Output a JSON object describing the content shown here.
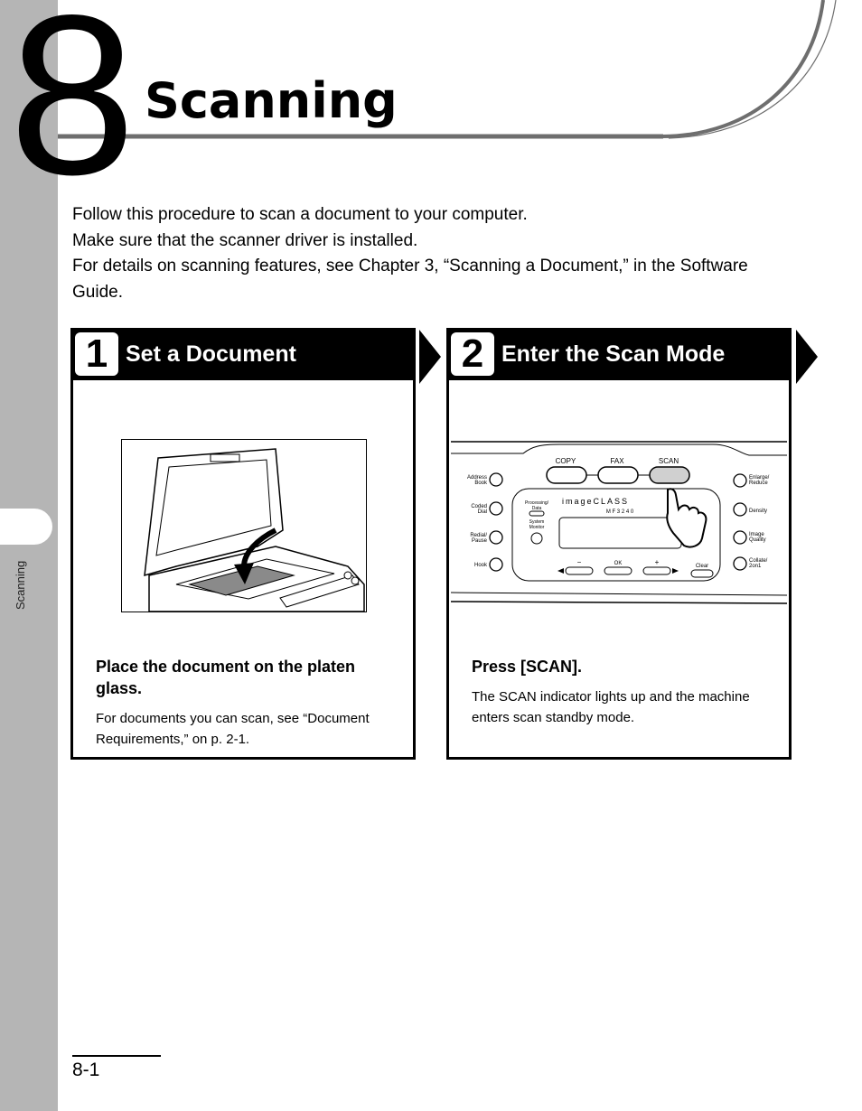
{
  "chapter": {
    "number": "8",
    "title": "Scanning"
  },
  "side_tab": {
    "label": "Scanning"
  },
  "intro": {
    "lines": [
      "Follow this procedure to scan a document to your computer.",
      "Make sure that the scanner driver is installed.",
      "For details on scanning features, see Chapter 3, “Scanning a Document,” in the Software Guide."
    ]
  },
  "steps": [
    {
      "number": "1",
      "title": "Set a Document",
      "lead": "Place the document on the platen glass.",
      "note": "For documents you can scan, see “Document Requirements,” on p. 2-1.",
      "illustration": "document-on-platen-glass"
    },
    {
      "number": "2",
      "title": "Enter the Scan Mode",
      "lead": "Press [SCAN].",
      "note": "The SCAN indicator lights up and the machine enters scan standby mode.",
      "illustration": "operation-panel-scan-key",
      "panel": {
        "mode_keys": [
          "COPY",
          "FAX",
          "SCAN"
        ],
        "brand": "imageCLASS",
        "model": "M F 3 2 4 0",
        "left_keys": [
          "Address Book",
          "Coded Dial",
          "Redial/ Pause",
          "Hook"
        ],
        "left_labels": [
          "Processing/ Data",
          "System Monitor"
        ],
        "right_keys": [
          "Enlarge/ Reduce",
          "Density",
          "Image Quality",
          "Collate/ 2on1"
        ],
        "nav_keys": [
          "−",
          "OK",
          "+",
          "Clear"
        ]
      }
    }
  ],
  "footer": {
    "page_number": "8-1"
  }
}
